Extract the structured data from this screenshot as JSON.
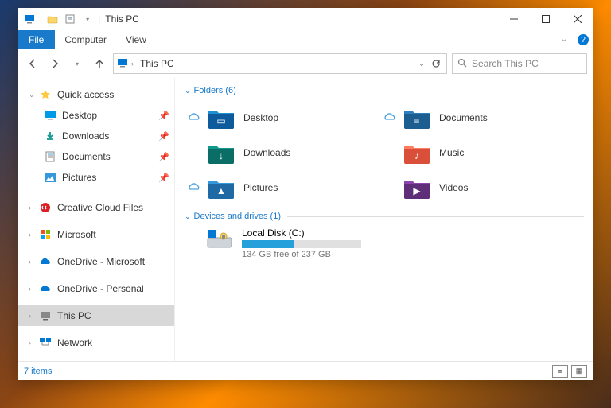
{
  "window": {
    "title": "This PC"
  },
  "ribbon": {
    "file": "File",
    "tabs": [
      "Computer",
      "View"
    ]
  },
  "address": {
    "crumb": "This PC"
  },
  "search": {
    "placeholder": "Search This PC"
  },
  "sidebar": {
    "quick": {
      "label": "Quick access",
      "items": [
        {
          "label": "Desktop",
          "icon": "desktop"
        },
        {
          "label": "Downloads",
          "icon": "downloads"
        },
        {
          "label": "Documents",
          "icon": "documents"
        },
        {
          "label": "Pictures",
          "icon": "pictures"
        }
      ]
    },
    "others": [
      {
        "label": "Creative Cloud Files",
        "icon": "cc"
      },
      {
        "label": "Microsoft",
        "icon": "ms"
      },
      {
        "label": "OneDrive - Microsoft",
        "icon": "onedrive"
      },
      {
        "label": "OneDrive - Personal",
        "icon": "onedrive"
      },
      {
        "label": "This PC",
        "icon": "pc",
        "selected": true
      },
      {
        "label": "Network",
        "icon": "network"
      }
    ]
  },
  "content": {
    "folders_header": "Folders (6)",
    "folders": [
      {
        "name": "Desktop",
        "cloud": true,
        "color1": "#1e90d2",
        "color2": "#0d5a9c",
        "glyph": "▭"
      },
      {
        "name": "Documents",
        "cloud": true,
        "color1": "#2d7fbf",
        "color2": "#1b5e8f",
        "glyph": "≡"
      },
      {
        "name": "Downloads",
        "cloud": false,
        "color1": "#11998e",
        "color2": "#0b6e66",
        "glyph": "↓"
      },
      {
        "name": "Music",
        "cloud": false,
        "color1": "#ff7e5f",
        "color2": "#d94f3a",
        "glyph": "♪"
      },
      {
        "name": "Pictures",
        "cloud": true,
        "color1": "#3498db",
        "color2": "#1f6aa5",
        "glyph": "▲"
      },
      {
        "name": "Videos",
        "cloud": false,
        "color1": "#8e44ad",
        "color2": "#5e2e78",
        "glyph": "▶"
      }
    ],
    "drives_header": "Devices and drives (1)",
    "drive": {
      "name": "Local Disk (C:)",
      "free_text": "134 GB free of 237 GB",
      "used_percent": 43
    }
  },
  "status": {
    "items": "7 items"
  }
}
